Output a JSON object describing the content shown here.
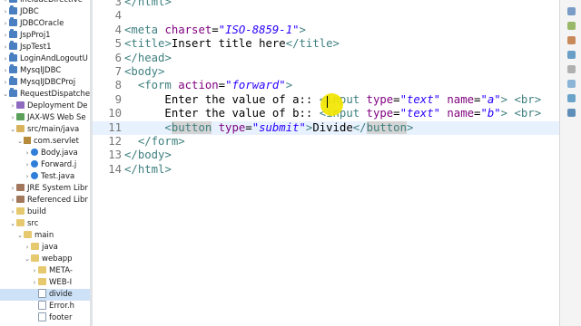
{
  "explorer": {
    "items": [
      {
        "label": "IncludeDirective",
        "indent": 0,
        "chev": "›",
        "icon": "proj"
      },
      {
        "label": "JDBC",
        "indent": 0,
        "chev": "›",
        "icon": "proj"
      },
      {
        "label": "JDBCOracle",
        "indent": 0,
        "chev": "›",
        "icon": "proj"
      },
      {
        "label": "JspProj1",
        "indent": 0,
        "chev": "›",
        "icon": "proj"
      },
      {
        "label": "JspTest1",
        "indent": 0,
        "chev": "›",
        "icon": "proj"
      },
      {
        "label": "LoginAndLogoutU",
        "indent": 0,
        "chev": "›",
        "icon": "proj"
      },
      {
        "label": "MysqlJDBC",
        "indent": 0,
        "chev": "›",
        "icon": "proj"
      },
      {
        "label": "MysqlJDBCProj",
        "indent": 0,
        "chev": "›",
        "icon": "proj"
      },
      {
        "label": "RequestDispatcher",
        "indent": 0,
        "chev": "⌄",
        "icon": "proj"
      },
      {
        "label": "Deployment De",
        "indent": 1,
        "chev": "›",
        "icon": "deploy"
      },
      {
        "label": "JAX-WS Web Se",
        "indent": 1,
        "chev": "›",
        "icon": "jaxws"
      },
      {
        "label": "src/main/java",
        "indent": 1,
        "chev": "⌄",
        "icon": "srcfolder"
      },
      {
        "label": "com.servlet",
        "indent": 2,
        "chev": "⌄",
        "icon": "pkg"
      },
      {
        "label": "Body.java",
        "indent": 3,
        "chev": "›",
        "icon": "java"
      },
      {
        "label": "Forward.j",
        "indent": 3,
        "chev": "›",
        "icon": "java"
      },
      {
        "label": "Test.java",
        "indent": 3,
        "chev": "›",
        "icon": "java"
      },
      {
        "label": "JRE System Libr",
        "indent": 1,
        "chev": "›",
        "icon": "lib"
      },
      {
        "label": "Referenced Libr",
        "indent": 1,
        "chev": "›",
        "icon": "lib"
      },
      {
        "label": "build",
        "indent": 1,
        "chev": "›",
        "icon": "folder"
      },
      {
        "label": "src",
        "indent": 1,
        "chev": "⌄",
        "icon": "folder"
      },
      {
        "label": "main",
        "indent": 2,
        "chev": "⌄",
        "icon": "folder"
      },
      {
        "label": "java",
        "indent": 3,
        "chev": "›",
        "icon": "folder"
      },
      {
        "label": "webapp",
        "indent": 3,
        "chev": "⌄",
        "icon": "folder"
      },
      {
        "label": "META-",
        "indent": 4,
        "chev": "›",
        "icon": "folder"
      },
      {
        "label": "WEB-I",
        "indent": 4,
        "chev": "›",
        "icon": "folder"
      },
      {
        "label": "divide",
        "indent": 4,
        "chev": "",
        "icon": "file",
        "selected": true
      },
      {
        "label": "Error.h",
        "indent": 4,
        "chev": "",
        "icon": "file"
      },
      {
        "label": "footer",
        "indent": 4,
        "chev": "",
        "icon": "file"
      }
    ]
  },
  "editor": {
    "current_line": 11,
    "lines": [
      {
        "no": "3",
        "tokens": [
          {
            "t": "tag",
            "v": "</"
          },
          {
            "t": "tag",
            "v": "html"
          },
          {
            "t": "tag",
            "v": ">"
          }
        ]
      },
      {
        "no": "4",
        "tokens": []
      },
      {
        "no": "4",
        "tokens": [
          {
            "t": "tag",
            "v": "<"
          },
          {
            "t": "tag",
            "v": "meta"
          },
          {
            "t": "txt",
            "v": " "
          },
          {
            "t": "attr",
            "v": "charset"
          },
          {
            "t": "txt",
            "v": "="
          },
          {
            "t": "val",
            "v": "\"ISO-8859-1\""
          },
          {
            "t": "tag",
            "v": ">"
          }
        ]
      },
      {
        "no": "5",
        "tokens": [
          {
            "t": "tag",
            "v": "<"
          },
          {
            "t": "tag",
            "v": "title"
          },
          {
            "t": "tag",
            "v": ">"
          },
          {
            "t": "txt",
            "v": "Insert title here"
          },
          {
            "t": "tag",
            "v": "</"
          },
          {
            "t": "tag",
            "v": "title"
          },
          {
            "t": "tag",
            "v": ">"
          }
        ]
      },
      {
        "no": "6",
        "tokens": [
          {
            "t": "tag",
            "v": "</"
          },
          {
            "t": "tag",
            "v": "head"
          },
          {
            "t": "tag",
            "v": ">"
          }
        ]
      },
      {
        "no": "7",
        "tokens": [
          {
            "t": "tag",
            "v": "<"
          },
          {
            "t": "tag",
            "v": "body"
          },
          {
            "t": "tag",
            "v": ">"
          }
        ]
      },
      {
        "no": "8",
        "tokens": [
          {
            "t": "txt",
            "v": "  "
          },
          {
            "t": "tag",
            "v": "<"
          },
          {
            "t": "tag",
            "v": "form"
          },
          {
            "t": "txt",
            "v": " "
          },
          {
            "t": "attr",
            "v": "action"
          },
          {
            "t": "txt",
            "v": "="
          },
          {
            "t": "val",
            "v": "\"forward\""
          },
          {
            "t": "tag",
            "v": ">"
          }
        ]
      },
      {
        "no": "9",
        "tokens": [
          {
            "t": "txt",
            "v": "      Enter the value of a:: "
          },
          {
            "t": "tag",
            "v": "<"
          },
          {
            "t": "tag",
            "v": "input"
          },
          {
            "t": "txt",
            "v": " "
          },
          {
            "t": "attr",
            "v": "type"
          },
          {
            "t": "txt",
            "v": "="
          },
          {
            "t": "val",
            "v": "\"text\""
          },
          {
            "t": "txt",
            "v": " "
          },
          {
            "t": "attr",
            "v": "name"
          },
          {
            "t": "txt",
            "v": "="
          },
          {
            "t": "val",
            "v": "\"a\""
          },
          {
            "t": "tag",
            "v": ">"
          },
          {
            "t": "txt",
            "v": " "
          },
          {
            "t": "tag",
            "v": "<"
          },
          {
            "t": "tag",
            "v": "br"
          },
          {
            "t": "tag",
            "v": ">"
          }
        ]
      },
      {
        "no": "10",
        "tokens": [
          {
            "t": "txt",
            "v": "      Enter the value of b:: "
          },
          {
            "t": "tag",
            "v": "<"
          },
          {
            "t": "tag",
            "v": "input"
          },
          {
            "t": "txt",
            "v": " "
          },
          {
            "t": "attr",
            "v": "type"
          },
          {
            "t": "txt",
            "v": "="
          },
          {
            "t": "val",
            "v": "\"text\""
          },
          {
            "t": "txt",
            "v": " "
          },
          {
            "t": "attr",
            "v": "name"
          },
          {
            "t": "txt",
            "v": "="
          },
          {
            "t": "val",
            "v": "\"b\""
          },
          {
            "t": "tag",
            "v": ">"
          },
          {
            "t": "txt",
            "v": " "
          },
          {
            "t": "tag",
            "v": "<"
          },
          {
            "t": "tag",
            "v": "br"
          },
          {
            "t": "tag",
            "v": ">"
          }
        ]
      },
      {
        "no": "11",
        "tokens": [
          {
            "t": "txt",
            "v": "      "
          },
          {
            "t": "tag",
            "v": "<"
          },
          {
            "t": "tag hl",
            "v": "button"
          },
          {
            "t": "txt",
            "v": " "
          },
          {
            "t": "attr",
            "v": "type"
          },
          {
            "t": "txt",
            "v": "="
          },
          {
            "t": "val",
            "v": "\"submit\""
          },
          {
            "t": "tag",
            "v": ">"
          },
          {
            "t": "txt",
            "v": "Divide"
          },
          {
            "t": "tag",
            "v": "</"
          },
          {
            "t": "tag hl",
            "v": "button"
          },
          {
            "t": "tag",
            "v": ">"
          }
        ]
      },
      {
        "no": "12",
        "tokens": [
          {
            "t": "txt",
            "v": "  "
          },
          {
            "t": "tag",
            "v": "</"
          },
          {
            "t": "tag",
            "v": "form"
          },
          {
            "t": "tag",
            "v": ">"
          }
        ]
      },
      {
        "no": "13",
        "tokens": [
          {
            "t": "tag",
            "v": "</"
          },
          {
            "t": "tag",
            "v": "body"
          },
          {
            "t": "tag",
            "v": ">"
          }
        ]
      },
      {
        "no": "14",
        "tokens": [
          {
            "t": "tag",
            "v": "</"
          },
          {
            "t": "tag",
            "v": "html"
          },
          {
            "t": "tag",
            "v": ">"
          }
        ]
      }
    ]
  },
  "colors": {
    "tag": "#3f7f7f",
    "attr": "#7f007f",
    "value": "#2a00ff",
    "current_line": "#e8f2fe",
    "cursor_highlight": "#f2e600"
  },
  "toolbar_icons": [
    "view-icon",
    "outline-icon",
    "task-icon",
    "problem-icon",
    "console-icon",
    "search-icon",
    "bookmark-icon",
    "server-icon"
  ]
}
